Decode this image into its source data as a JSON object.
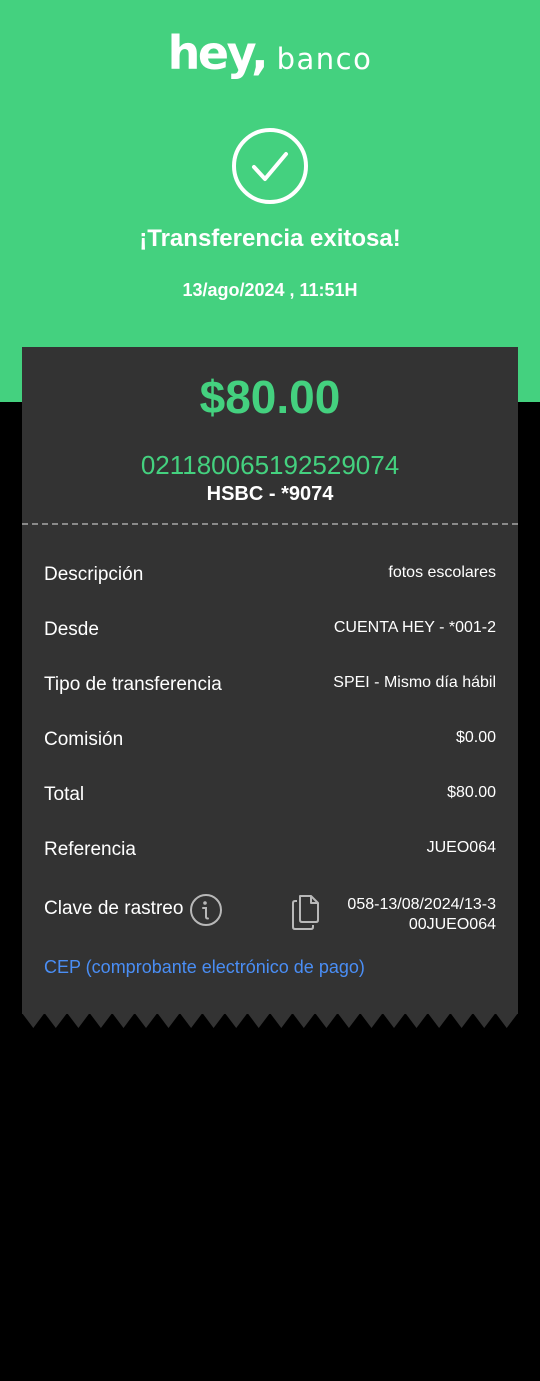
{
  "brand": {
    "logo_main": "hey",
    "logo_comma": ",",
    "logo_sub": "banco"
  },
  "header": {
    "title": "¡Transferencia exitosa!",
    "datetime": "13/ago/2024 , 11:51H",
    "status_icon": "check-circle-icon"
  },
  "transfer": {
    "amount": "$80.00",
    "account_number": "021180065192529074",
    "bank": "HSBC - *9074"
  },
  "details": {
    "descripcion": {
      "label": "Descripción",
      "value": "fotos escolares"
    },
    "desde": {
      "label": "Desde",
      "value": "CUENTA HEY - *001-2"
    },
    "tipo": {
      "label": "Tipo de transferencia",
      "value": "SPEI - Mismo día hábil"
    },
    "comision": {
      "label": "Comisión",
      "value": "$0.00"
    },
    "total": {
      "label": "Total",
      "value": "$80.00"
    },
    "referencia": {
      "label": "Referencia",
      "value": "JUEO064"
    },
    "rastreo": {
      "label": "Clave de rastreo",
      "value_line1": "058-13/08/2024/13-3",
      "value_line2": "00JUEO064",
      "info_icon": "info-icon",
      "copy_icon": "copy-icon"
    }
  },
  "cep_link": "CEP (comprobante electrónico de pago)",
  "colors": {
    "accent_green": "#44d17f",
    "receipt_bg": "#333333",
    "link_blue": "#4a8ef5",
    "page_bg": "#000000"
  }
}
